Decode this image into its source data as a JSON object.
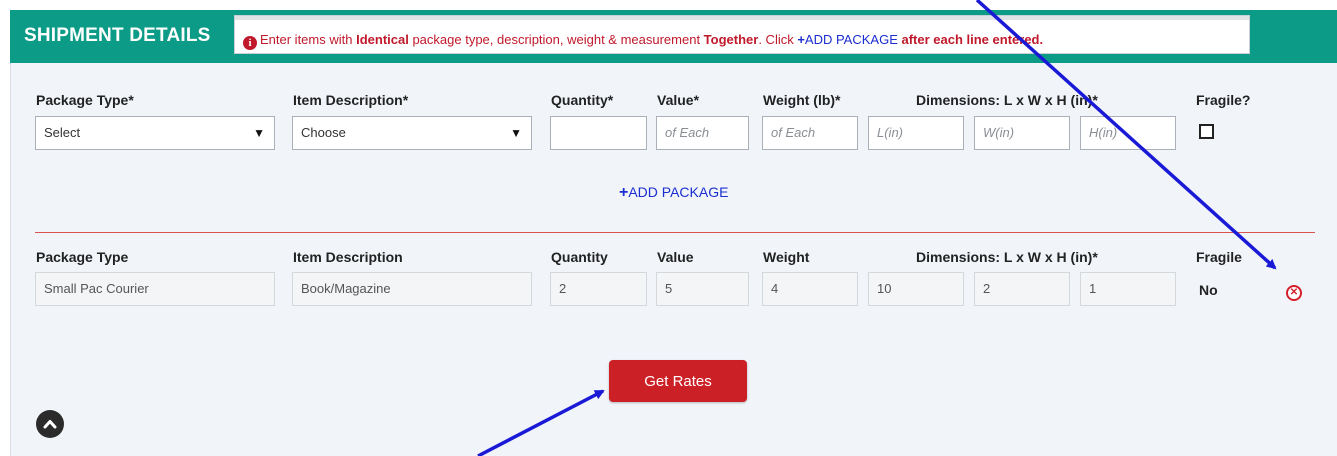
{
  "header": {
    "title": "SHIPMENT DETAILS",
    "notice": {
      "part1": "Enter items with ",
      "bold1": "Identical",
      "part2": " package type, description, weight & measurement ",
      "bold2": "Together",
      "part3": ".  Click ",
      "add_label": "ADD PACKAGE",
      "bold3": " after each line entered."
    }
  },
  "form": {
    "labels": {
      "package_type": "Package Type*",
      "item_description": "Item Description*",
      "quantity": "Quantity*",
      "value": "Value*",
      "weight": "Weight (lb)*",
      "dimensions": "Dimensions: L x W x H (in)*",
      "fragile": "Fragile?"
    },
    "package_type_value": "Select",
    "item_description_value": "Choose",
    "quantity_value": "",
    "value_placeholder": "of Each",
    "weight_placeholder": "of Each",
    "length_placeholder": "L(in)",
    "width_placeholder": "W(in)",
    "height_placeholder": "H(in)",
    "add_package_label": "ADD PACKAGE"
  },
  "packages": {
    "labels": {
      "package_type": "Package Type",
      "item_description": "Item Description",
      "quantity": "Quantity",
      "value": "Value",
      "weight": "Weight",
      "dimensions": "Dimensions: L x W x H (in)*",
      "fragile": "Fragile"
    },
    "row": {
      "package_type": "Small Pac Courier",
      "item_description": "Book/Magazine",
      "quantity": "2",
      "value": "5",
      "weight": "4",
      "length": "10",
      "width": "2",
      "height": "1",
      "fragile": "No"
    }
  },
  "actions": {
    "get_rates_label": "Get Rates"
  },
  "colors": {
    "header_bg": "#0c9b86",
    "accent_red": "#cc2027",
    "link_blue": "#1b2ecf",
    "annotation_arrow": "#1a1ad6"
  },
  "icons": {
    "notice": "info-circle-icon",
    "remove": "remove-circle-icon",
    "scroll": "chevron-up-icon",
    "add": "plus-icon"
  }
}
